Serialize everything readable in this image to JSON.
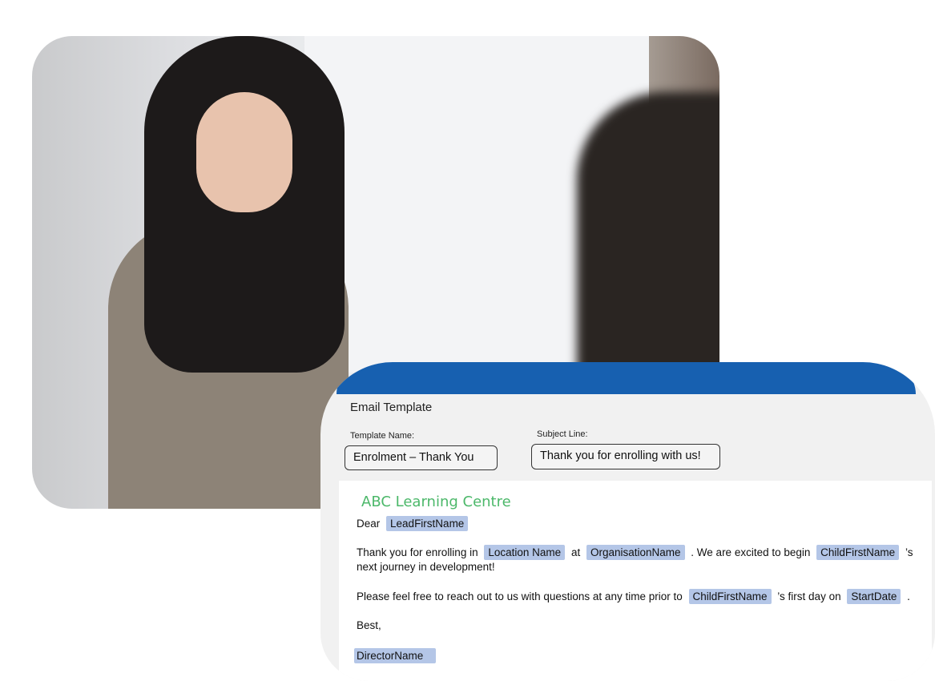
{
  "photo": {
    "alt_subject": "meeting-photo"
  },
  "card": {
    "title": "Email Template",
    "template_name_label": "Template Name:",
    "template_name_value": "Enrolment – Thank You",
    "subject_label": "Subject Line:",
    "subject_value": "Thank you for enrolling with us!",
    "accent_color": "#1760b0",
    "email": {
      "brand": "ABC Learning Centre",
      "brand_color": "#4cb86a",
      "dear": "Dear",
      "lead_first_name": "LeadFirstName",
      "p1_a": "Thank you for enrolling in",
      "location_name": "Location Name",
      "p1_at": "at",
      "organisation_name": "OrganisationName",
      "p1_b": ".  We are excited to begin",
      "child_first_name": "ChildFirstName",
      "p1_c": "’s",
      "p1_d": "next journey in development!",
      "p2_a": "Please feel free to reach out to us with questions at any time prior to",
      "p2_b": "’s  first day on",
      "start_date": "StartDate",
      "p2_c": ".",
      "sign_off": "Best,",
      "director_name": "DirectorName",
      "tag_color": "#b4c6e7"
    }
  }
}
